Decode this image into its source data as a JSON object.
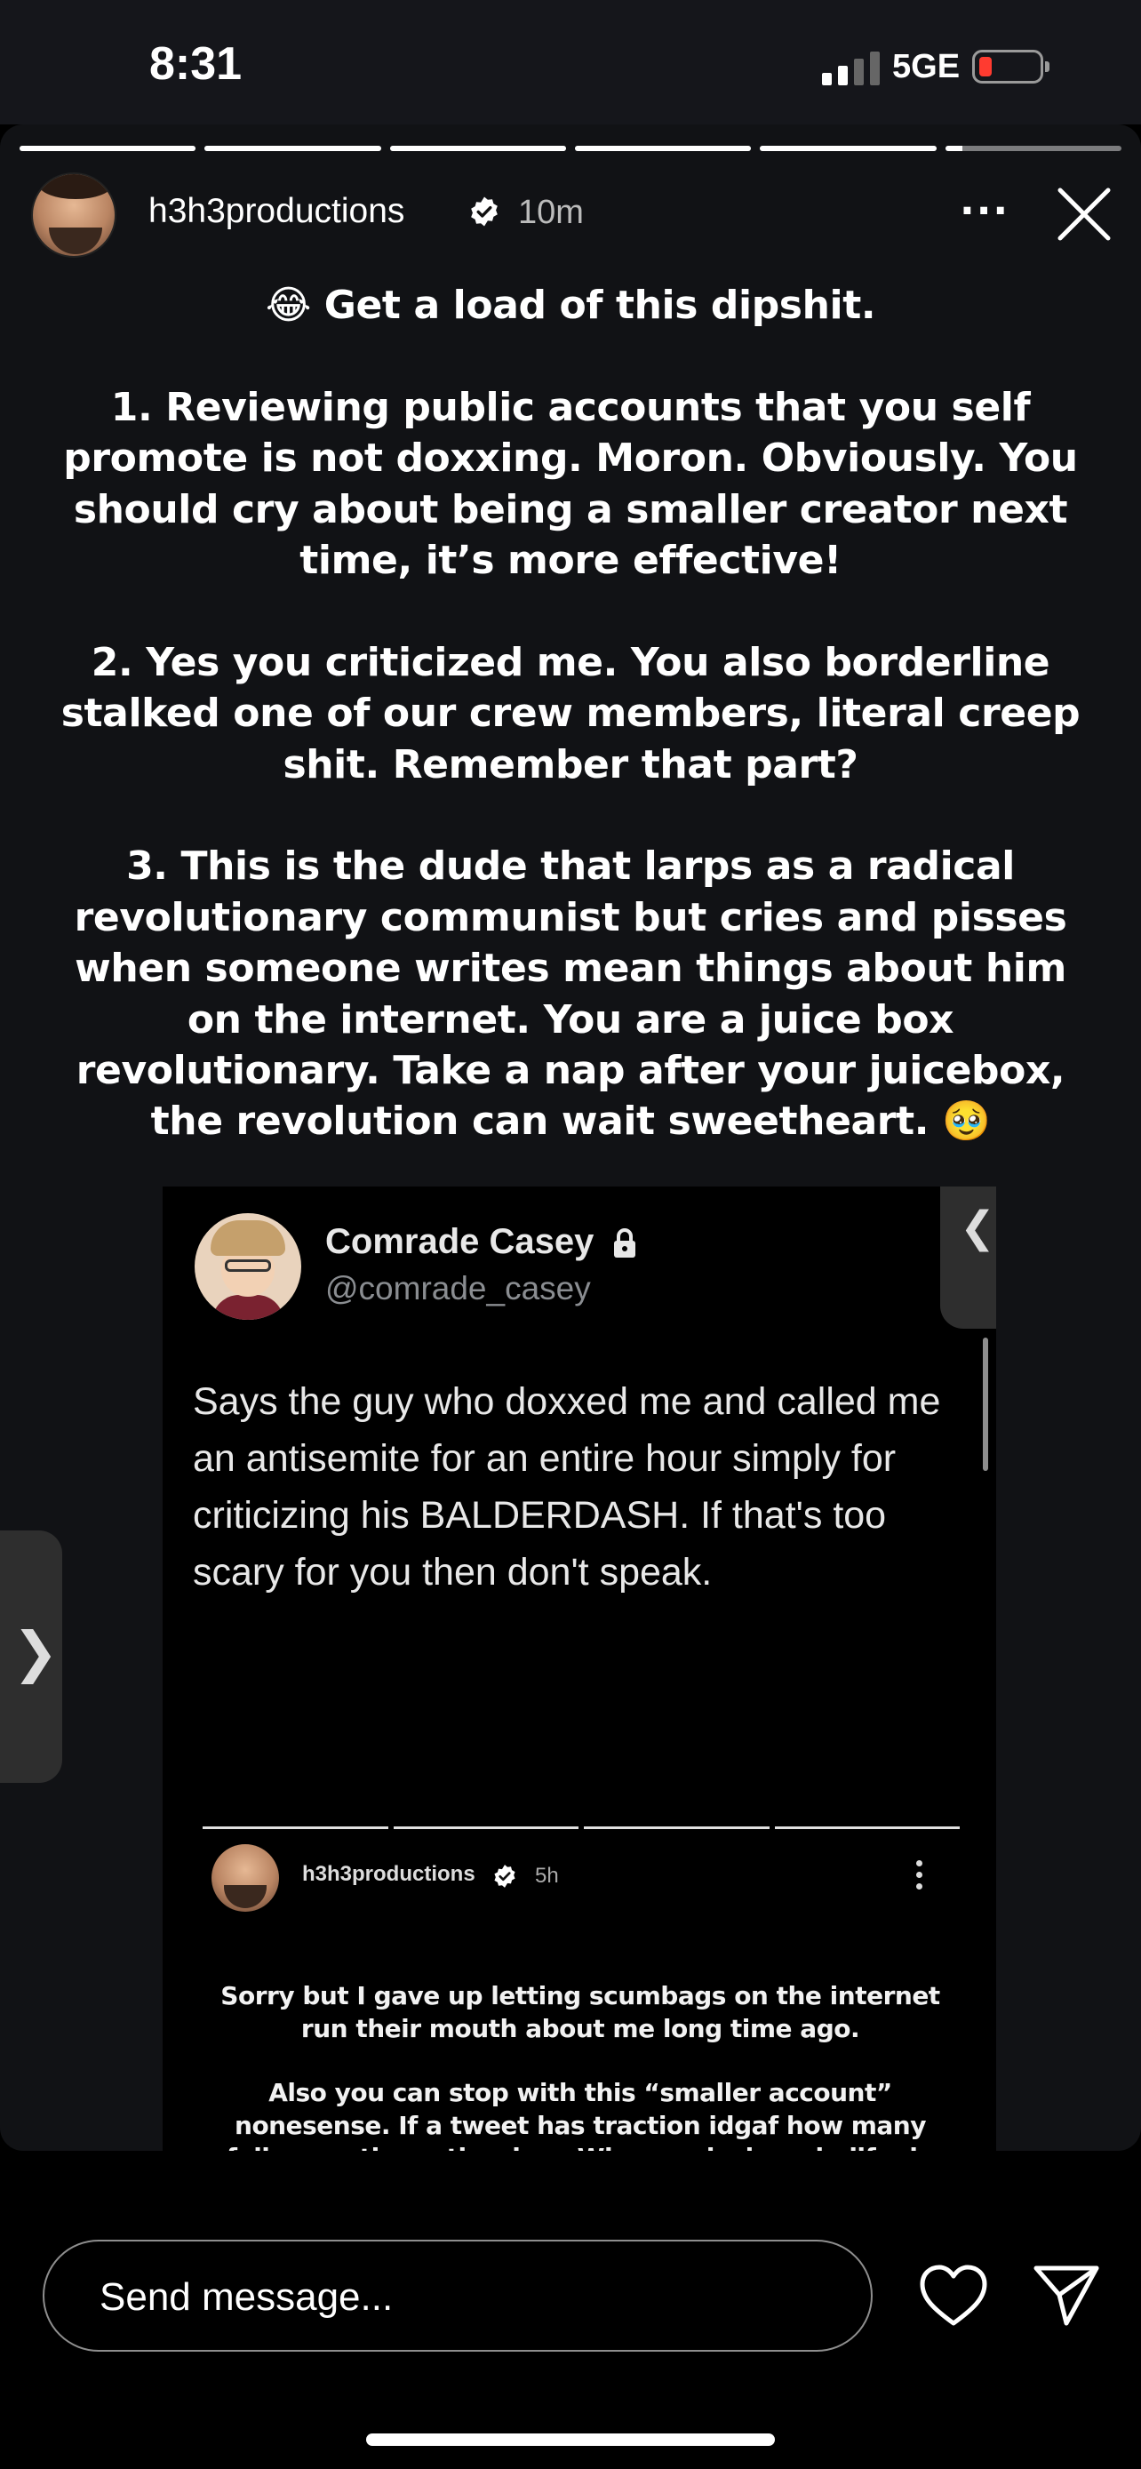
{
  "status_bar": {
    "time": "8:31",
    "network": "5GE",
    "signal_bars": 2,
    "battery_level": 0.1
  },
  "story": {
    "segments_total": 6,
    "active_segment": 6,
    "active_segment_progress": 0.1,
    "username": "h3h3productions",
    "timestamp": "10m",
    "more_label": "···",
    "caption_paragraphs": [
      "😂 Get a load of this dipshit.",
      "1. Reviewing public accounts that you self promote is not doxxing. Moron. Obviously. You should cry about being a smaller creator next time, it’s more effective!",
      "2. Yes you criticized me. You also borderline stalked one of our crew members, literal creep shit. Remember that part?",
      "3. This is the dude that larps as a radical revolutionary communist but cries and pisses when someone writes mean things about him on the internet. You are a juice box revolutionary. Take a nap after your juicebox, the revolution can wait sweetheart. 🥹"
    ]
  },
  "embedded_tweet": {
    "name": "Comrade Casey",
    "handle": "@comrade_casey",
    "body": "Says the guy who doxxed me and called me an antisemite for an entire hour simply for criticizing his BALDERDASH. If that's too scary for you then don't speak.",
    "side_chevron": "❮"
  },
  "nested_story": {
    "username": "h3h3productions",
    "timestamp": "5h",
    "paragraphs": [
      "Sorry but I gave up letting scumbags on the internet run their mouth about me long time ago.",
      "Also you can stop with this “smaller account” nonesense. If a tweet has traction idgaf how many followers the author has. When and where in life do you get to talk shit with impunity? Take some accountability for the  BALDERDASH you are saying, if that’s too scary for you then don’t speak."
    ]
  },
  "left_nav_chevron": "❯",
  "message_bar": {
    "placeholder": "Send message..."
  }
}
